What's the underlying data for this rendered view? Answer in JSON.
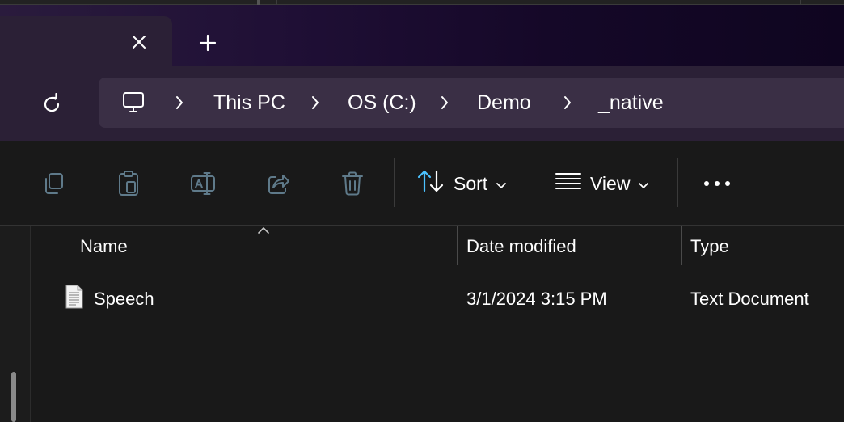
{
  "tabs": {
    "close_icon": "close-icon",
    "new_tab_icon": "plus-icon"
  },
  "address": {
    "refresh_icon": "refresh-icon",
    "root_icon": "computer-icon",
    "breadcrumbs": [
      "This PC",
      "OS (C:)",
      "Demo",
      "_native"
    ]
  },
  "toolbar": {
    "copy_icon": "copy-icon",
    "paste_icon": "paste-icon",
    "rename_icon": "rename-icon",
    "share_icon": "share-icon",
    "delete_icon": "delete-icon",
    "sort_label": "Sort",
    "view_label": "View",
    "more_icon": "more-icon"
  },
  "columns": {
    "name": "Name",
    "date_modified": "Date modified",
    "type": "Type"
  },
  "files": [
    {
      "name": "Speech",
      "date_modified": "3/1/2024 3:15 PM",
      "type": "Text Document",
      "icon": "text-document-icon"
    }
  ],
  "colors": {
    "accent": "#4cc2ff",
    "icon_disabled": "#5f7a8a",
    "titlebar_start": "#2a1b3d",
    "titlebar_end": "#0f0520"
  }
}
